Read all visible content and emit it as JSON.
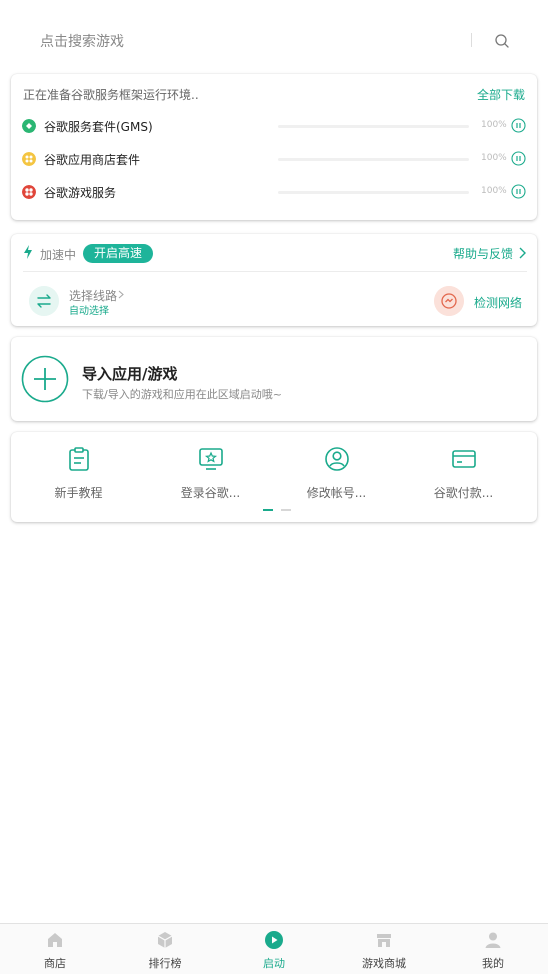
{
  "search": {
    "placeholder": "点击搜索游戏",
    "icon": "search-icon"
  },
  "download": {
    "status": "正在准备谷歌服务框架运行环境..",
    "all_label": "全部下载",
    "items": [
      {
        "name": "谷歌服务套件(GMS)",
        "percent": "100%",
        "progress": 0,
        "icon": "gms-icon",
        "color": "#2bb673"
      },
      {
        "name": "谷歌应用商店套件",
        "percent": "100%",
        "progress": 0,
        "icon": "store-icon",
        "color": "#f4c542"
      },
      {
        "name": "谷歌游戏服务",
        "percent": "100%",
        "progress": 0,
        "icon": "games-icon",
        "color": "#e0463a"
      }
    ]
  },
  "accelerate": {
    "label": "加速中",
    "pill": "开启高速",
    "help": "帮助与反馈",
    "route_label": "选择线路",
    "route_value": "自动选择",
    "detect_label": "检测网络"
  },
  "import": {
    "title": "导入应用/游戏",
    "subtitle": "下载/导入的游戏和应用在此区域启动哦~"
  },
  "tools": [
    {
      "label": "新手教程",
      "icon": "clipboard-icon"
    },
    {
      "label": "登录谷歌...",
      "icon": "monitor-star-icon"
    },
    {
      "label": "修改帐号...",
      "icon": "user-circle-icon"
    },
    {
      "label": "谷歌付款...",
      "icon": "card-icon"
    }
  ],
  "nav": [
    {
      "label": "商店",
      "icon": "home-icon",
      "active": false
    },
    {
      "label": "排行榜",
      "icon": "cube-icon",
      "active": false
    },
    {
      "label": "启动",
      "icon": "play-icon",
      "active": true
    },
    {
      "label": "游戏商城",
      "icon": "shop-icon",
      "active": false
    },
    {
      "label": "我的",
      "icon": "person-icon",
      "active": false
    }
  ],
  "colors": {
    "accent": "#1aaa8c",
    "pill": "#1eb49a",
    "detect_bg": "#fbe1da"
  }
}
